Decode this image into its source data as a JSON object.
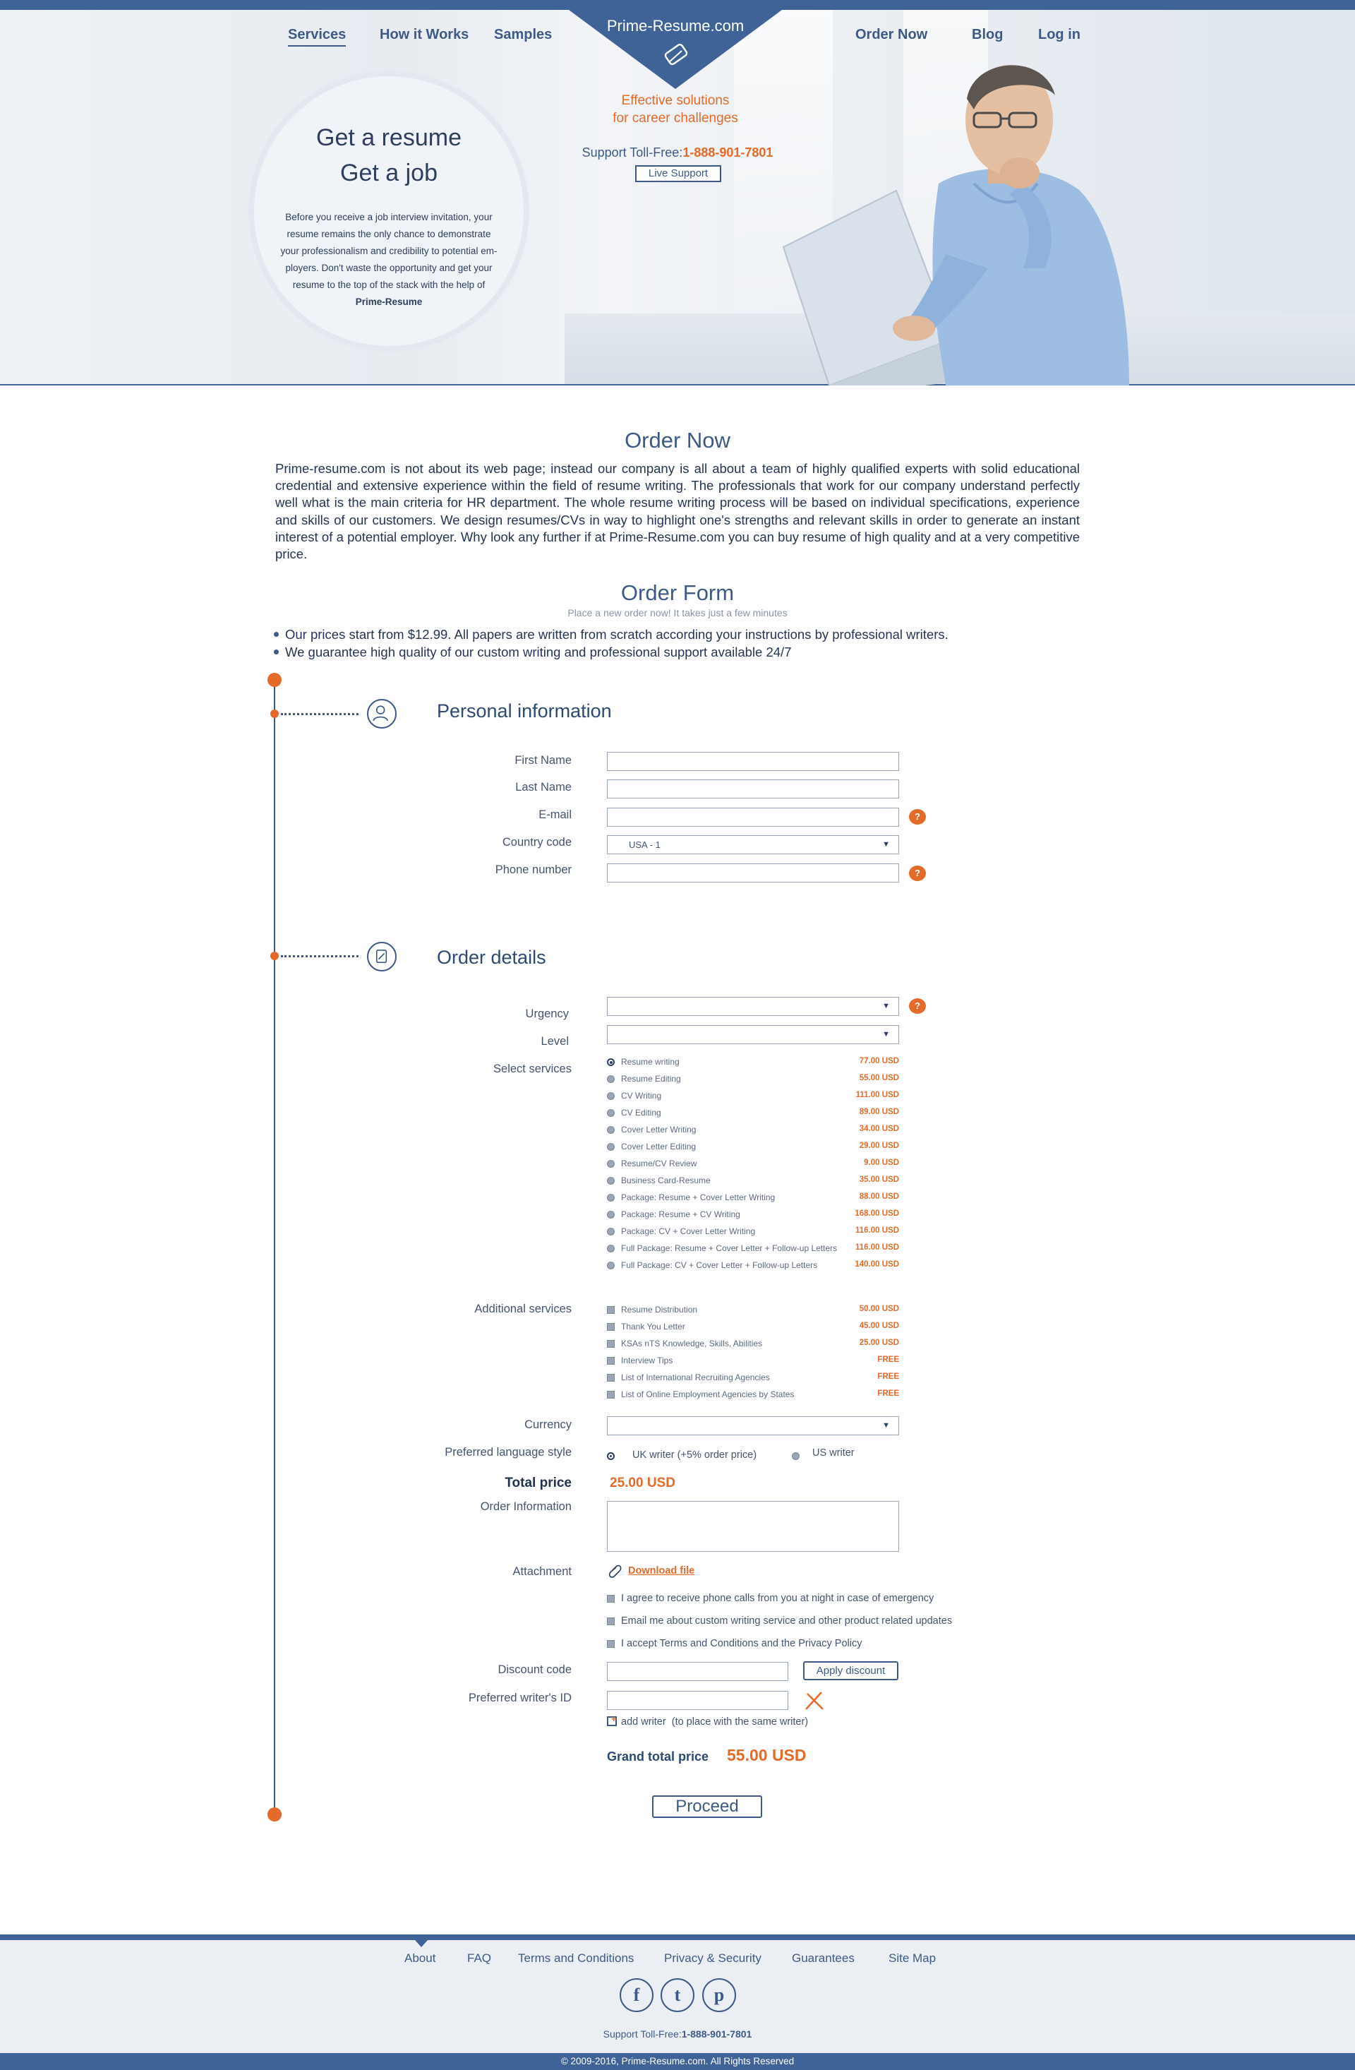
{
  "nav": {
    "services": "Services",
    "how_it_works": "How it Works",
    "samples": "Samples",
    "order_now": "Order Now",
    "blog": "Blog",
    "login": "Log in"
  },
  "brand": {
    "logo": "Prime-Resume.com",
    "tagline_1": "Effective solutions",
    "tagline_2": "for career challenges",
    "support_label": "Support Toll-Free:",
    "support_phone": "1-888-901-7801",
    "live_support": "Live Support"
  },
  "hero": {
    "title_1": "Get a resume",
    "title_2": "Get a job",
    "body_lines": [
      "Before you receive a job interview invitation, your",
      "resume remains the only chance to demonstrate",
      "your professionalism and credibility to potential em-",
      "ployers. Don't waste the opportunity and get your",
      "resume to the top of the stack with the help of"
    ],
    "brand": "Prime-Resume"
  },
  "order_now": {
    "title": "Order Now",
    "paragraph": "Prime-resume.com is not about its web page; instead our company is all about a team of highly qualified experts with solid educational credential and extensive experience within the field of resume writing. The professionals that work for our company understand perfectly well what is the main criteria for HR department. The whole resume writing process will be based on individual specifications, experience and skills of our customers. We design resumes/CVs in way to highlight one's strengths and relevant skills in order to generate an instant interest of a potential employer. Why look any further if at Prime-Resume.com you can buy resume of high quality and at a very competitive price."
  },
  "order_form": {
    "title": "Order Form",
    "subtitle": "Place a new order now! It takes just a few minutes",
    "bullets": [
      "Our prices start from $12.99. All papers are written from scratch according your instructions by professional writers.",
      "We guarantee high quality of our custom writing and professional support available 24/7"
    ]
  },
  "personal": {
    "title": "Personal information",
    "first_name": "First Name",
    "last_name": "Last Name",
    "email": "E-mail",
    "country_code": "Country code",
    "country_value": "USA - 1",
    "phone": "Phone number"
  },
  "order_details": {
    "title": "Order details",
    "urgency": "Urgency",
    "level": "Level",
    "select_services": "Select services",
    "services": [
      {
        "name": "Resume writing",
        "price": "77.00 USD"
      },
      {
        "name": "Resume Editing",
        "price": "55.00 USD"
      },
      {
        "name": "CV Writing",
        "price": "111.00 USD"
      },
      {
        "name": "CV Editing",
        "price": "89.00 USD"
      },
      {
        "name": "Cover Letter Writing",
        "price": "34.00 USD"
      },
      {
        "name": "Cover Letter Editing",
        "price": "29.00 USD"
      },
      {
        "name": "Resume/CV Review",
        "price": "9.00 USD"
      },
      {
        "name": "Business Card-Resume",
        "price": "35.00 USD"
      },
      {
        "name": "Package: Resume + Cover Letter Writing",
        "price": "88.00 USD"
      },
      {
        "name": "Package: Resume + CV Writing",
        "price": "168.00 USD"
      },
      {
        "name": "Package: CV + Cover Letter Writing",
        "price": "116.00 USD"
      },
      {
        "name": "Full Package: Resume + Cover Letter + Follow-up Letters",
        "price": "116.00 USD"
      },
      {
        "name": "Full Package: CV + Cover Letter + Follow-up Letters",
        "price": "140.00 USD"
      }
    ],
    "additional_services": "Additional services",
    "additional": [
      {
        "name": "Resume Distribution",
        "price": "50.00 USD"
      },
      {
        "name": "Thank You Letter",
        "price": "45.00 USD"
      },
      {
        "name": "KSAs nTS Knowledge, Skills, Abilities",
        "price": "25.00 USD"
      },
      {
        "name": "Interview Tips",
        "price": "FREE"
      },
      {
        "name": "List of International Recruiting Agencies",
        "price": "FREE"
      },
      {
        "name": "List of Online Employment Agencies by States",
        "price": "FREE"
      }
    ],
    "currency": "Currency",
    "language_style": "Preferred language style",
    "uk_writer": "UK writer (+5% order price)",
    "us_writer": "US writer",
    "total_price_label": "Total price",
    "total_price": "25.00 USD",
    "order_information": "Order Information",
    "attachment": "Attachment",
    "download_file": "Download file",
    "agree_1": "I agree to receive phone calls from you at night in case of emergency",
    "agree_2": "Email me about custom writing service and other product related updates",
    "agree_3": "I accept Terms and Conditions and the Privacy Policy",
    "discount_code": "Discount code",
    "apply_discount": "Apply discount",
    "writer_id": "Preferred writer's ID",
    "add_writer": "add writer",
    "add_writer_note": "(to place with the same writer)",
    "grand_total_label": "Grand total price",
    "grand_total": "55.00 USD",
    "proceed": "Proceed"
  },
  "footer": {
    "links": [
      "About",
      "FAQ",
      "Terms and Conditions",
      "Privacy & Security",
      "Guarantees",
      "Site Map"
    ],
    "social": [
      "f",
      "t",
      "p"
    ],
    "support_label": "Support Toll-Free:",
    "support_phone": "1-888-901-7801",
    "copyright": "© 2009-2016, Prime-Resume.com. All Rights Reserved"
  },
  "colors": {
    "brand_blue": "#3f6396",
    "accent_orange": "#e56a2a"
  },
  "icons": [
    "user-icon",
    "document-icon",
    "help-icon",
    "paperclip-icon",
    "clear-icon",
    "facebook-icon",
    "twitter-icon",
    "pinterest-icon"
  ]
}
